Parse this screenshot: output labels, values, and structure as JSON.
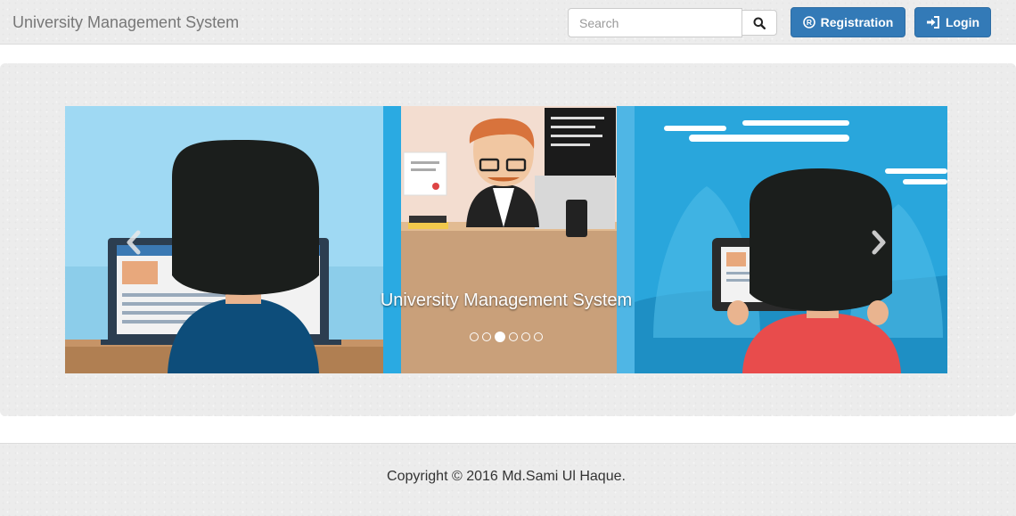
{
  "navbar": {
    "brand": "University Management System",
    "search": {
      "placeholder": "Search",
      "value": ""
    },
    "search_button_icon": "search-icon",
    "registration_label": "Registration",
    "registration_icon": "registered-icon",
    "login_label": "Login",
    "login_icon": "log-in-icon"
  },
  "carousel": {
    "caption": "University Management System",
    "slide_count": 6,
    "active_index": 2,
    "prev_icon": "chevron-left-icon",
    "next_icon": "chevron-right-icon"
  },
  "footer": {
    "copyright": "Copyright © 2016 Md.Sami Ul Haque."
  },
  "colors": {
    "primary": "#337ab7",
    "background_texture": "#ececec"
  }
}
